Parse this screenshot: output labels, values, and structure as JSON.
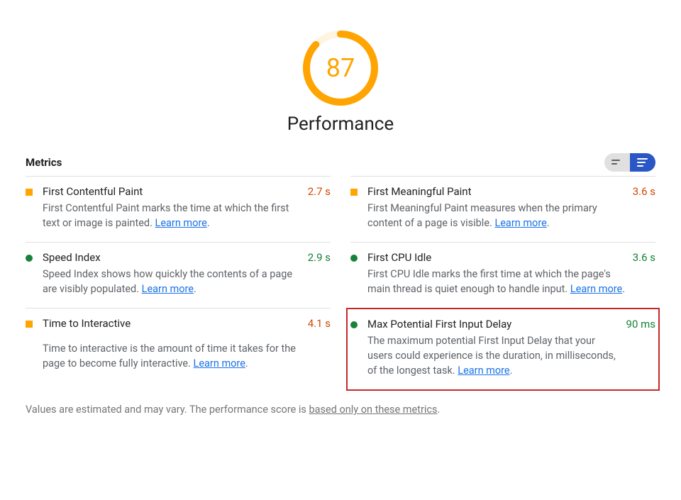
{
  "score": {
    "value": 87,
    "title": "Performance",
    "color": "#ffa400",
    "arc_fraction": 0.87
  },
  "metrics_heading": "Metrics",
  "learn_more_label": "Learn more",
  "metrics": [
    {
      "id": "fcp",
      "bullet": "square",
      "title": "First Contentful Paint",
      "desc_pre": "First Contentful Paint marks the time at which the first text or image is painted. ",
      "value": "2.7 s",
      "value_class": "val-orange"
    },
    {
      "id": "fmp",
      "bullet": "square",
      "title": "First Meaningful Paint",
      "desc_pre": "First Meaningful Paint measures when the primary content of a page is visible. ",
      "value": "3.6 s",
      "value_class": "val-orange"
    },
    {
      "id": "si",
      "bullet": "circle",
      "title": "Speed Index",
      "desc_pre": "Speed Index shows how quickly the contents of a page are visibly populated. ",
      "value": "2.9 s",
      "value_class": "val-green"
    },
    {
      "id": "fci",
      "bullet": "circle",
      "title": "First CPU Idle",
      "desc_pre": "First CPU Idle marks the first time at which the page's main thread is quiet enough to handle input. ",
      "value": "3.6 s",
      "value_class": "val-green"
    },
    {
      "id": "tti",
      "bullet": "square",
      "title": "Time to Interactive",
      "desc_pre": "Time to interactive is the amount of time it takes for the page to become fully interactive. ",
      "value": "4.1 s",
      "value_class": "val-orange"
    },
    {
      "id": "mpfid",
      "bullet": "circle",
      "title": "Max Potential First Input Delay",
      "desc_pre": "The maximum potential First Input Delay that your users could experience is the duration, in milliseconds, of the longest task. ",
      "value": "90 ms",
      "value_class": "val-green",
      "highlighted": true
    }
  ],
  "footnote": {
    "pre": "Values are estimated and may vary. The performance score is ",
    "link": "based only on these metrics",
    "post": "."
  }
}
